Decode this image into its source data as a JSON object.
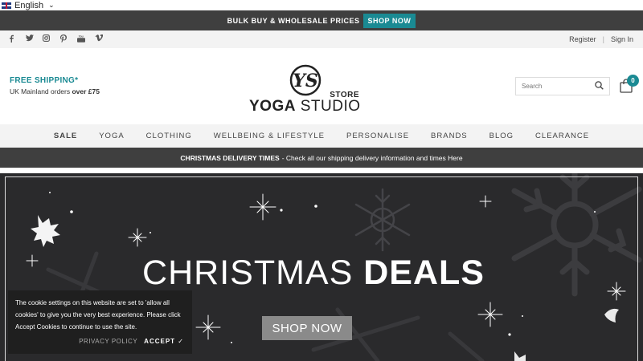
{
  "language": {
    "label": "English",
    "flag_icon": "uk-flag-icon"
  },
  "promo": {
    "text": "BULK BUY & WHOLESALE PRICES",
    "button": "SHOP NOW"
  },
  "social": {
    "icons": [
      "facebook-icon",
      "twitter-icon",
      "instagram-icon",
      "pinterest-icon",
      "youtube-icon",
      "vimeo-icon"
    ]
  },
  "account": {
    "register": "Register",
    "sign_in": "Sign In"
  },
  "shipping": {
    "title": "FREE SHIPPING*",
    "line_prefix": "UK Mainland orders ",
    "line_bold": "over £75"
  },
  "logo": {
    "monogram": "YS",
    "store": "STORE",
    "name_bold": "YOGA",
    "name_rest": " STUDIO"
  },
  "search": {
    "placeholder": "Search"
  },
  "cart": {
    "count": "0"
  },
  "nav": {
    "items": [
      "SALE",
      "YOGA",
      "CLOTHING",
      "WELLBEING & LIFESTYLE",
      "PERSONALISE",
      "BRANDS",
      "BLOG",
      "CLEARANCE"
    ]
  },
  "delivery": {
    "bold": "CHRISTMAS DELIVERY TIMES",
    "text": "- Check all our shipping delivery information and times Here"
  },
  "hero": {
    "title_light": "CHRISTMAS ",
    "title_bold": "DEALS",
    "button": "SHOP NOW"
  },
  "cookie": {
    "text": "The cookie settings on this website are set to 'allow all cookies' to give you the very best experience. Please click Accept Cookies to continue to use the site.",
    "privacy": "PRIVACY POLICY",
    "accept": "ACCEPT ✓"
  },
  "colors": {
    "accent": "#1a8a93",
    "dark_bar": "#3f3f3f",
    "hero_bg": "#2a2a2c"
  }
}
